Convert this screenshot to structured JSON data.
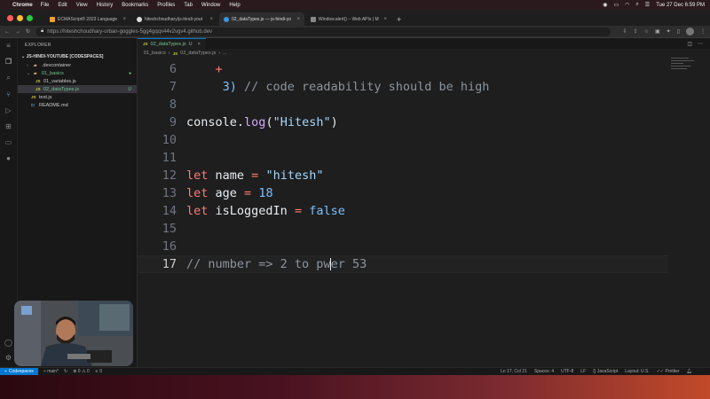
{
  "menubar": {
    "app": "Chrome",
    "items": [
      "File",
      "Edit",
      "View",
      "History",
      "Bookmarks",
      "Profiles",
      "Tab",
      "Window",
      "Help"
    ],
    "clock": "Tue 27 Dec 6:59 PM"
  },
  "browser": {
    "tabs": [
      {
        "title": "ECMAScript® 2023 Language",
        "color": "#f0a030"
      },
      {
        "title": "hiteshchoudhary/js-hindi-yout",
        "color": "#dddddd"
      },
      {
        "title": "02_dataTypes.js — js-hindi-yo",
        "color": "#3a96dd",
        "active": true
      },
      {
        "title": "Window.alert() – Web APIs | M",
        "color": "#888888"
      }
    ],
    "url": "https://hiteshchoudhary-urban-goggles-5gg4gqqx44v2vgv4.github.dev"
  },
  "explorer": {
    "title": "EXPLORER",
    "root": "JS-HINDI-YOUTUBE [CODESPACES]",
    "items": [
      {
        "label": ".devcontainer",
        "type": "folder",
        "indent": 1
      },
      {
        "label": "01_basics",
        "type": "folder-open",
        "indent": 1,
        "modified": true
      },
      {
        "label": "01_variables.js",
        "type": "js",
        "indent": 2
      },
      {
        "label": "02_dataTypes.js",
        "type": "js",
        "indent": 2,
        "modified": true,
        "selected": true,
        "badge": "U"
      },
      {
        "label": "test.js",
        "type": "js",
        "indent": 1
      },
      {
        "label": "README.md",
        "type": "md",
        "indent": 1
      }
    ]
  },
  "editor": {
    "tab": {
      "label": "02_dataTypes.js",
      "badge": "U"
    },
    "breadcrumb": [
      "01_basics",
      "02_dataTypes.js",
      "..."
    ],
    "current_line": 17
  },
  "code_lines": [
    {
      "n": "6",
      "tokens": [
        {
          "t": "    +",
          "c": "o"
        }
      ]
    },
    {
      "n": "7",
      "tokens": [
        {
          "t": "     3) ",
          "c": "n"
        },
        {
          "t": "// code readability should be high",
          "c": "cm"
        }
      ]
    },
    {
      "n": "8",
      "tokens": []
    },
    {
      "n": "9",
      "tokens": [
        {
          "t": "console",
          "c": "plain"
        },
        {
          "t": ".",
          "c": "plain"
        },
        {
          "t": "log",
          "c": "fn"
        },
        {
          "t": "(",
          "c": "plain"
        },
        {
          "t": "\"Hitesh\"",
          "c": "s"
        },
        {
          "t": ")",
          "c": "plain"
        }
      ]
    },
    {
      "n": "10",
      "tokens": []
    },
    {
      "n": "11",
      "tokens": []
    },
    {
      "n": "12",
      "tokens": [
        {
          "t": "let",
          "c": "k"
        },
        {
          "t": " name ",
          "c": "v"
        },
        {
          "t": "=",
          "c": "o"
        },
        {
          "t": " ",
          "c": "v"
        },
        {
          "t": "\"hitesh\"",
          "c": "s"
        }
      ]
    },
    {
      "n": "13",
      "tokens": [
        {
          "t": "let",
          "c": "k"
        },
        {
          "t": " age ",
          "c": "v"
        },
        {
          "t": "=",
          "c": "o"
        },
        {
          "t": " ",
          "c": "v"
        },
        {
          "t": "18",
          "c": "n"
        }
      ]
    },
    {
      "n": "14",
      "tokens": [
        {
          "t": "let",
          "c": "k"
        },
        {
          "t": " isLoggedIn ",
          "c": "v"
        },
        {
          "t": "=",
          "c": "o"
        },
        {
          "t": " ",
          "c": "v"
        },
        {
          "t": "false",
          "c": "n"
        }
      ]
    },
    {
      "n": "15",
      "tokens": []
    },
    {
      "n": "16",
      "tokens": []
    },
    {
      "n": "17",
      "tokens": [
        {
          "t": "// number => 2 to pw",
          "c": "cm"
        },
        {
          "t": "|",
          "c": "cursor"
        },
        {
          "t": "er 53",
          "c": "cm"
        }
      ]
    }
  ],
  "statusbar": {
    "remote": "Codespaces",
    "branch": "main*",
    "errors": "0",
    "warnings": "0",
    "ports": "0",
    "position": "Ln 17, Col 21",
    "spaces": "Spaces: 4",
    "encoding": "UTF-8",
    "eol": "LF",
    "language": "JavaScript",
    "layout": "Layout: U.S.",
    "prettier": "Prettier"
  },
  "colors": {
    "accent": "#0078d4",
    "git_modified": "#73c991",
    "js_icon": "#cbcb41"
  }
}
